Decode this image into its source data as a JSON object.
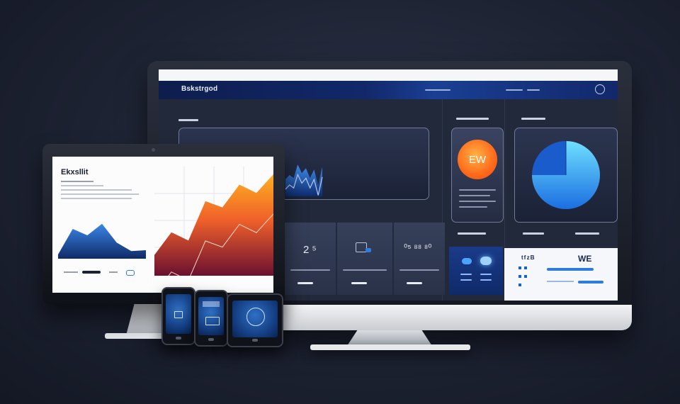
{
  "dashboard": {
    "brand": "Bskstrgod",
    "sections": {
      "tiles": [
        {
          "value": "2 ⁵"
        },
        {
          "value": ""
        },
        {
          "value": "⁰⁵ ⁸⁸ ⁸⁰"
        }
      ],
      "badge_text": "EW",
      "bottom_right": {
        "left_text": "ᵗᶠᶻᴮ",
        "right_text": "WE"
      }
    }
  },
  "laptop": {
    "title": "Ekxsllit"
  },
  "tablet": {
    "label": ""
  },
  "phone_middle": {
    "label": ""
  },
  "colors": {
    "background": "#1d2232",
    "nav": "#12286a",
    "accent_orange": "#ff7a1a",
    "accent_blue": "#1b8bf0",
    "panel": "#22293a"
  },
  "chart_data": [
    {
      "type": "area",
      "series": [
        {
          "values": [
            28,
            35,
            30,
            52,
            38,
            46,
            30,
            44,
            18,
            48
          ]
        }
      ]
    },
    {
      "type": "pie",
      "values": [
        75,
        25
      ]
    },
    {
      "type": "area",
      "series": [
        {
          "values": [
            20,
            42,
            34,
            72,
            66,
            88,
            80,
            98
          ]
        }
      ]
    },
    {
      "type": "area",
      "series": [
        {
          "values": [
            10,
            70,
            55,
            82,
            38,
            18,
            20
          ]
        }
      ]
    }
  ]
}
